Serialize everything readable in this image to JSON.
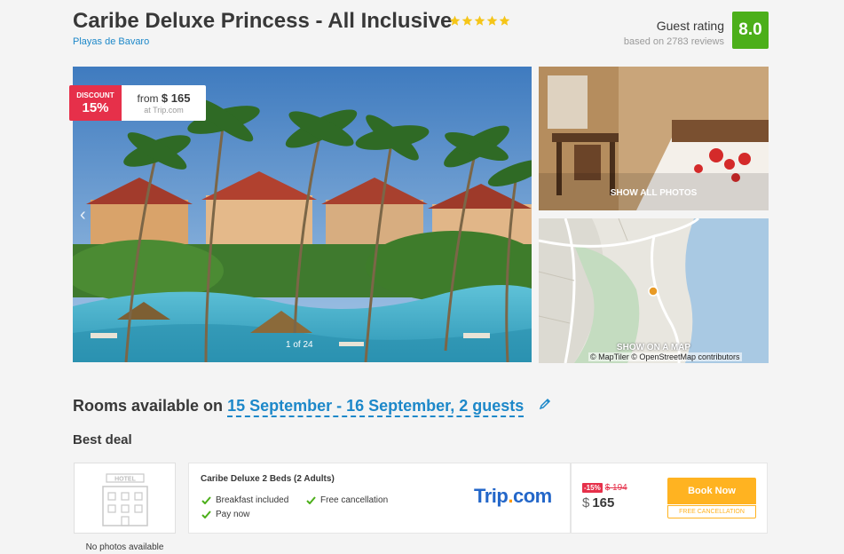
{
  "hotel": {
    "name": "Caribe Deluxe Princess - All Inclusive",
    "stars": 5,
    "location": "Playas de Bavaro",
    "guest_rating_label": "Guest rating",
    "reviews_text": "based on 2783 reviews",
    "rating": "8.0"
  },
  "gallery": {
    "discount_label": "DISCOUNT",
    "discount_value": "15%",
    "from_label": "from",
    "from_currency": "$",
    "from_price": "165",
    "price_source": "at Trip.com",
    "counter": "1 of 24",
    "show_all_label": "SHOW ALL PHOTOS",
    "show_map_label": "SHOW ON A MAP",
    "map_credit": "© MapTiler © OpenStreetMap contributors"
  },
  "rooms": {
    "heading_prefix": "Rooms available on",
    "dates_guests": "15 September - 16 September, 2 guests",
    "best_deal": "Best deal",
    "no_photos": "No photos available",
    "room_name": "Caribe Deluxe 2 Beds (2 Adults)",
    "amenities": [
      "Breakfast included",
      "Free cancellation",
      "Pay now"
    ],
    "provider_main": "Trip",
    "provider_dot": ".",
    "provider_tail": "com",
    "discount_badge": "-15%",
    "old_price": "$ 194",
    "currency": "$",
    "price": "165",
    "book_label": "Book Now",
    "free_cancel_label": "FREE CANCELLATION"
  },
  "colors": {
    "accent_blue": "#1d88c9",
    "rating_green": "#4caf1a",
    "discount_red": "#e6304a",
    "book_orange": "#ffb321",
    "star_gold": "#f5c518"
  }
}
